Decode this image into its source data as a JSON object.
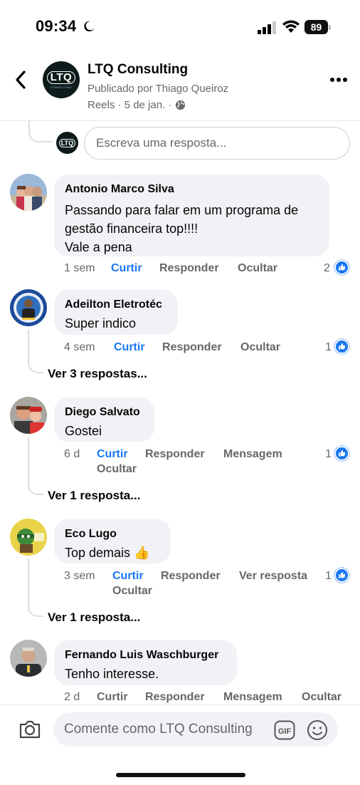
{
  "status": {
    "time": "09:34",
    "battery": "89"
  },
  "header": {
    "page_name": "LTQ Consulting",
    "posted_by": "Publicado por Thiago Queiroz",
    "meta": "Reels · 5 de jan. ·",
    "logo_text": "LTQ",
    "logo_sub": "CONSULTING"
  },
  "reply_box": {
    "placeholder": "Escreva uma resposta...",
    "logo_text": "LTQ"
  },
  "comments": [
    {
      "author": "Antonio Marco Silva",
      "lines": [
        "Passando para falar em um programa de",
        "gestão financeira top!!!!",
        "Vale a pena"
      ],
      "time": "1 sem",
      "like": "Curtir",
      "reply": "Responder",
      "hide": "Ocultar",
      "count": "2"
    },
    {
      "author": "Adeilton Eletrotéc",
      "text": "Super indico",
      "time": "4 sem",
      "like": "Curtir",
      "reply": "Responder",
      "hide": "Ocultar",
      "count": "1",
      "see_replies": "Ver 3 respostas..."
    },
    {
      "author": "Diego Salvato",
      "text": "Gostei",
      "time": "6 d",
      "like": "Curtir",
      "reply": "Responder",
      "message": "Mensagem",
      "hide": "Ocultar",
      "count": "1",
      "see_replies": "Ver 1 resposta..."
    },
    {
      "author": "Eco Lugo",
      "text": "Top demais 👍",
      "time": "3 sem",
      "like": "Curtir",
      "reply": "Responder",
      "view_reply": "Ver resposta",
      "hide": "Ocultar",
      "count": "1",
      "see_replies": "Ver 1 resposta..."
    },
    {
      "author": "Fernando Luis Waschburger",
      "text": "Tenho interesse.",
      "time": "2 d",
      "like": "Curtir",
      "reply": "Responder",
      "message": "Mensagem",
      "hide": "Ocultar"
    }
  ],
  "composer": {
    "placeholder": "Comente como LTQ Consulting"
  },
  "colors": {
    "accent": "#1877f2",
    "bubble": "#f0f2f5",
    "muted": "#65676b"
  },
  "icons": [
    "back-icon",
    "more-icon",
    "globe-icon",
    "moon-icon",
    "signal-icon",
    "wifi-icon",
    "like-icon",
    "camera-icon",
    "gif-icon",
    "emoji-icon"
  ]
}
